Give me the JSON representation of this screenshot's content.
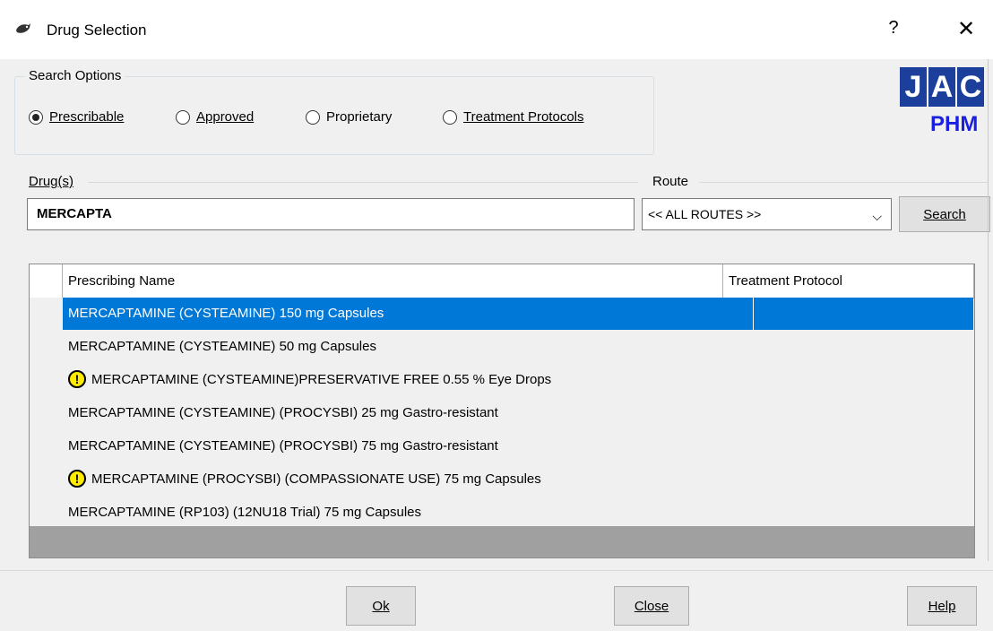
{
  "window": {
    "title": "Drug Selection",
    "help_glyph": "?",
    "close_glyph": "✕"
  },
  "search_options": {
    "legend": "Search Options",
    "options": [
      {
        "label": "Prescribable",
        "checked": true
      },
      {
        "label": "Approved",
        "checked": false
      },
      {
        "label": "Proprietary",
        "checked": false
      },
      {
        "label": "Treatment Protocols",
        "checked": false
      }
    ]
  },
  "logo": {
    "letters": [
      "J",
      "A",
      "C"
    ],
    "subtitle": "PHM"
  },
  "drug": {
    "label": "Drug(s)",
    "value": "MERCAPTA"
  },
  "route": {
    "label": "Route",
    "value": "<< ALL ROUTES >>",
    "chevron": "⌵"
  },
  "search_button": "Search",
  "grid": {
    "columns": [
      "Prescribing Name",
      "Treatment Protocol"
    ],
    "rows": [
      {
        "name": "MERCAPTAMINE  (CYSTEAMINE) 150 mg Capsules",
        "protocol": "",
        "warning": false,
        "selected": true
      },
      {
        "name": "MERCAPTAMINE  (CYSTEAMINE) 50 mg Capsules",
        "protocol": "",
        "warning": false,
        "selected": false
      },
      {
        "name": "MERCAPTAMINE  (CYSTEAMINE)PRESERVATIVE FREE 0.55 % Eye Drops",
        "protocol": "",
        "warning": true,
        "selected": false
      },
      {
        "name": "MERCAPTAMINE (CYSTEAMINE) (PROCYSBI) 25 mg Gastro-resistant",
        "protocol": "",
        "warning": false,
        "selected": false
      },
      {
        "name": "MERCAPTAMINE (CYSTEAMINE) (PROCYSBI) 75 mg Gastro-resistant",
        "protocol": "",
        "warning": false,
        "selected": false
      },
      {
        "name": "MERCAPTAMINE (PROCYSBI) (COMPASSIONATE USE) 75 mg Capsules",
        "protocol": "",
        "warning": true,
        "selected": false
      },
      {
        "name": "MERCAPTAMINE (RP103) (12NU18 Trial) 75 mg Capsules",
        "protocol": "",
        "warning": false,
        "selected": false
      }
    ],
    "warning_glyph": "!"
  },
  "buttons": {
    "ok": "Ok",
    "close": "Close",
    "help": "Help"
  },
  "colors": {
    "selection": "#0078d7",
    "logo_box": "#1b3f9a",
    "logo_text": "#1b1fe0",
    "warning": "#ffeb00"
  }
}
